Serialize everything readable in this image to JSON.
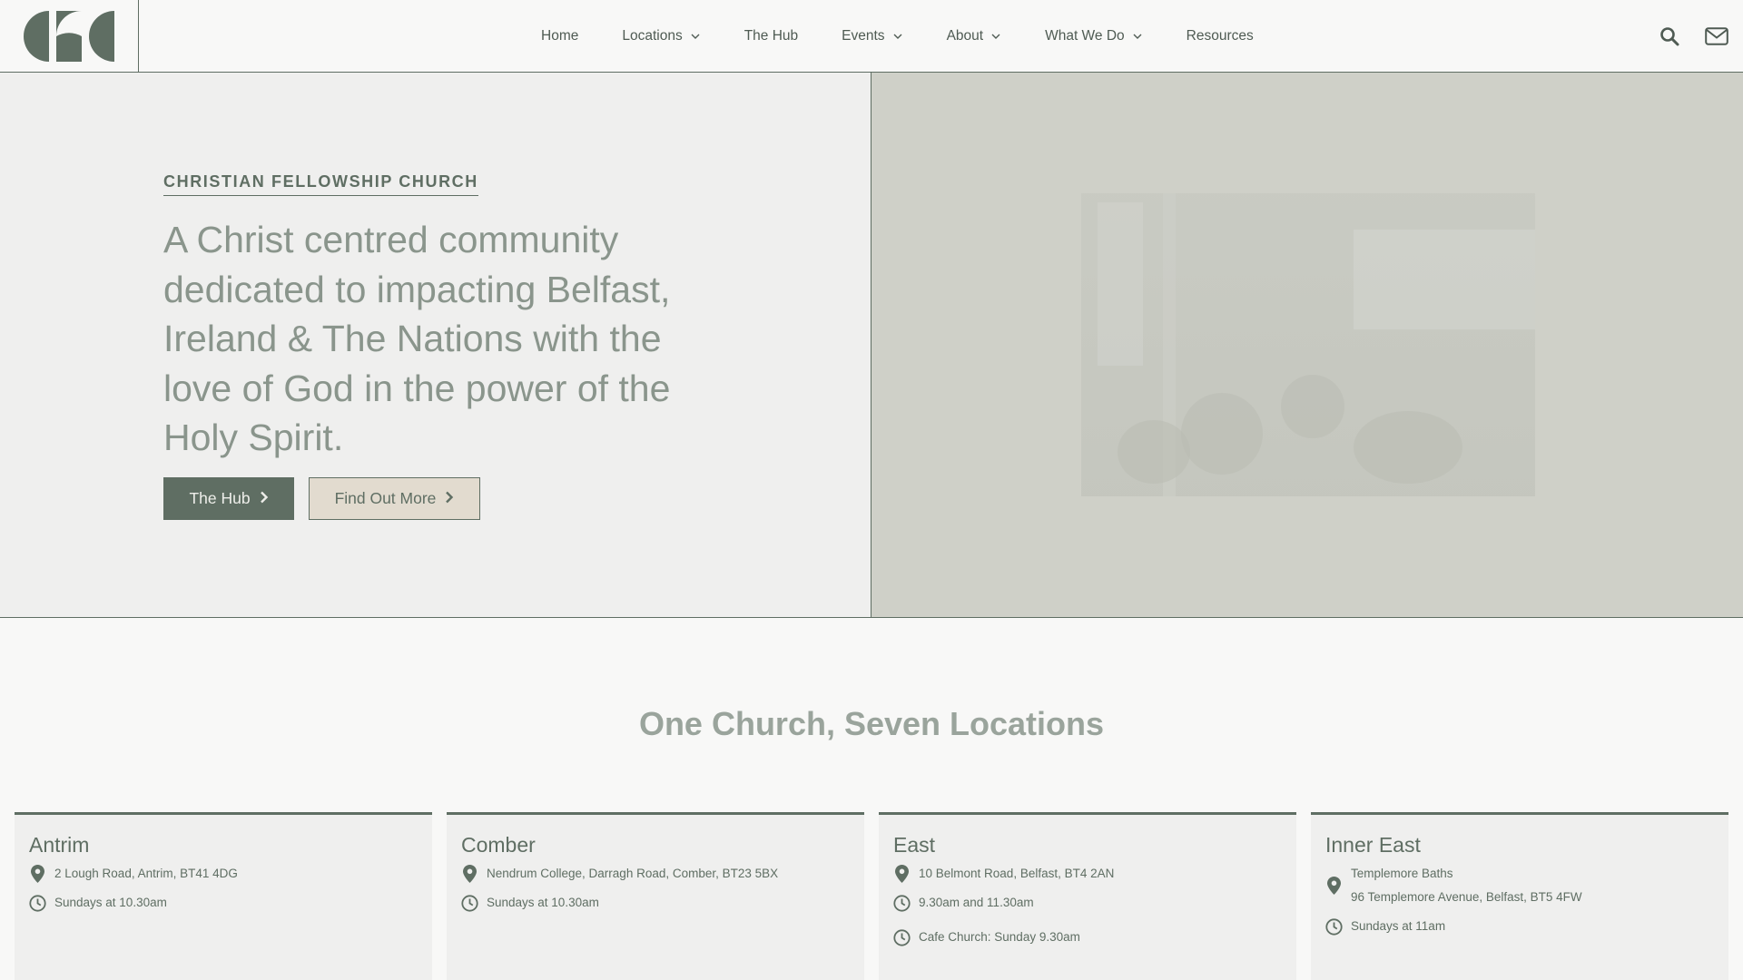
{
  "header": {
    "logo_alt": "CFC",
    "nav": [
      {
        "label": "Home",
        "has_dropdown": false
      },
      {
        "label": "Locations",
        "has_dropdown": true
      },
      {
        "label": "The Hub",
        "has_dropdown": false
      },
      {
        "label": "Events",
        "has_dropdown": true
      },
      {
        "label": "About",
        "has_dropdown": true
      },
      {
        "label": "What We Do",
        "has_dropdown": true
      },
      {
        "label": "Resources",
        "has_dropdown": false
      }
    ],
    "icons": [
      "search-icon",
      "mail-icon"
    ]
  },
  "hero": {
    "eyebrow": "CHRISTIAN FELLOWSHIP CHURCH",
    "heading": "A Christ centred community dedicated to impacting Belfast, Ireland & The Nations with the love of God in the power of the Holy Spirit.",
    "buttons": [
      {
        "label": "The Hub"
      },
      {
        "label": "Find Out More"
      }
    ]
  },
  "locations": {
    "title": "One Church, Seven Locations",
    "cards": [
      {
        "name": "Antrim",
        "address": [
          "2 Lough Road, Antrim, BT41 4DG"
        ],
        "times": [
          "Sundays at 10.30am"
        ]
      },
      {
        "name": "Comber",
        "address": [
          "Nendrum College, Darragh Road, Comber, BT23 5BX"
        ],
        "times": [
          "Sundays at 10.30am"
        ]
      },
      {
        "name": "East",
        "address": [
          "10 Belmont Road, Belfast, BT4 2AN"
        ],
        "times": [
          "9.30am and 11.30am",
          "Cafe Church: Sunday 9.30am"
        ]
      },
      {
        "name": "Inner East",
        "address": [
          "Templemore Baths",
          "96 Templemore Avenue, Belfast, BT5 4FW"
        ],
        "times": [
          "Sundays at 11am"
        ]
      }
    ]
  },
  "colors": {
    "brand": "#5f6e63",
    "sand": "#e2dbcf",
    "hero_left_bg": "#efefee",
    "hero_right_bg": "#cfd0c8"
  }
}
